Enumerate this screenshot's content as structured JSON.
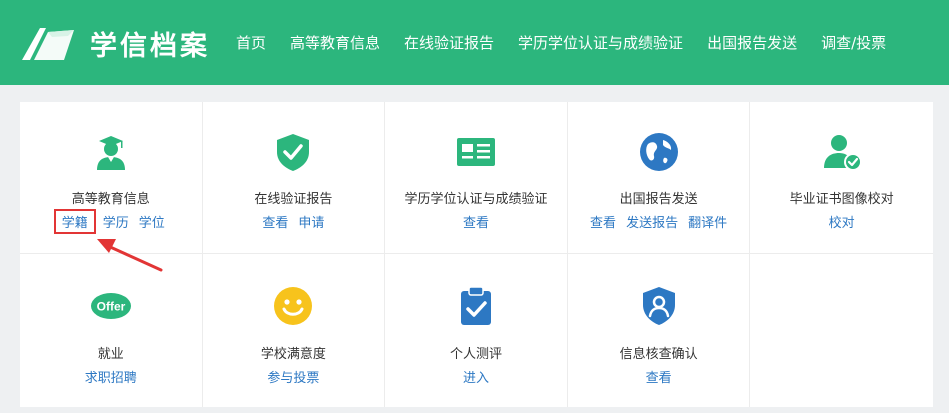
{
  "header": {
    "logo_text": "学信档案",
    "nav": [
      "首页",
      "高等教育信息",
      "在线验证报告",
      "学历学位认证与成绩验证",
      "出国报告发送",
      "调查/投票"
    ]
  },
  "cards": [
    {
      "title": "高等教育信息",
      "icon": "graduate-icon",
      "links": [
        "学籍",
        "学历",
        "学位"
      ]
    },
    {
      "title": "在线验证报告",
      "icon": "shield-check-icon",
      "links": [
        "查看",
        "申请"
      ]
    },
    {
      "title": "学历学位认证与成绩验证",
      "icon": "id-card-icon",
      "links": [
        "查看"
      ]
    },
    {
      "title": "出国报告发送",
      "icon": "globe-icon",
      "links": [
        "查看",
        "发送报告",
        "翻译件"
      ]
    },
    {
      "title": "毕业证书图像校对",
      "icon": "user-check-icon",
      "links": [
        "校对"
      ]
    },
    {
      "title": "就业",
      "icon": "offer-icon",
      "icon_text": "Offer",
      "links": [
        "求职招聘"
      ]
    },
    {
      "title": "学校满意度",
      "icon": "smiley-icon",
      "links": [
        "参与投票"
      ]
    },
    {
      "title": "个人测评",
      "icon": "clipboard-check-icon",
      "links": [
        "进入"
      ]
    },
    {
      "title": "信息核查确认",
      "icon": "user-shield-icon",
      "links": [
        "查看"
      ]
    }
  ],
  "colors": {
    "brand": "#2cb67d",
    "link": "#2d78c3",
    "highlight": "#e23535"
  }
}
